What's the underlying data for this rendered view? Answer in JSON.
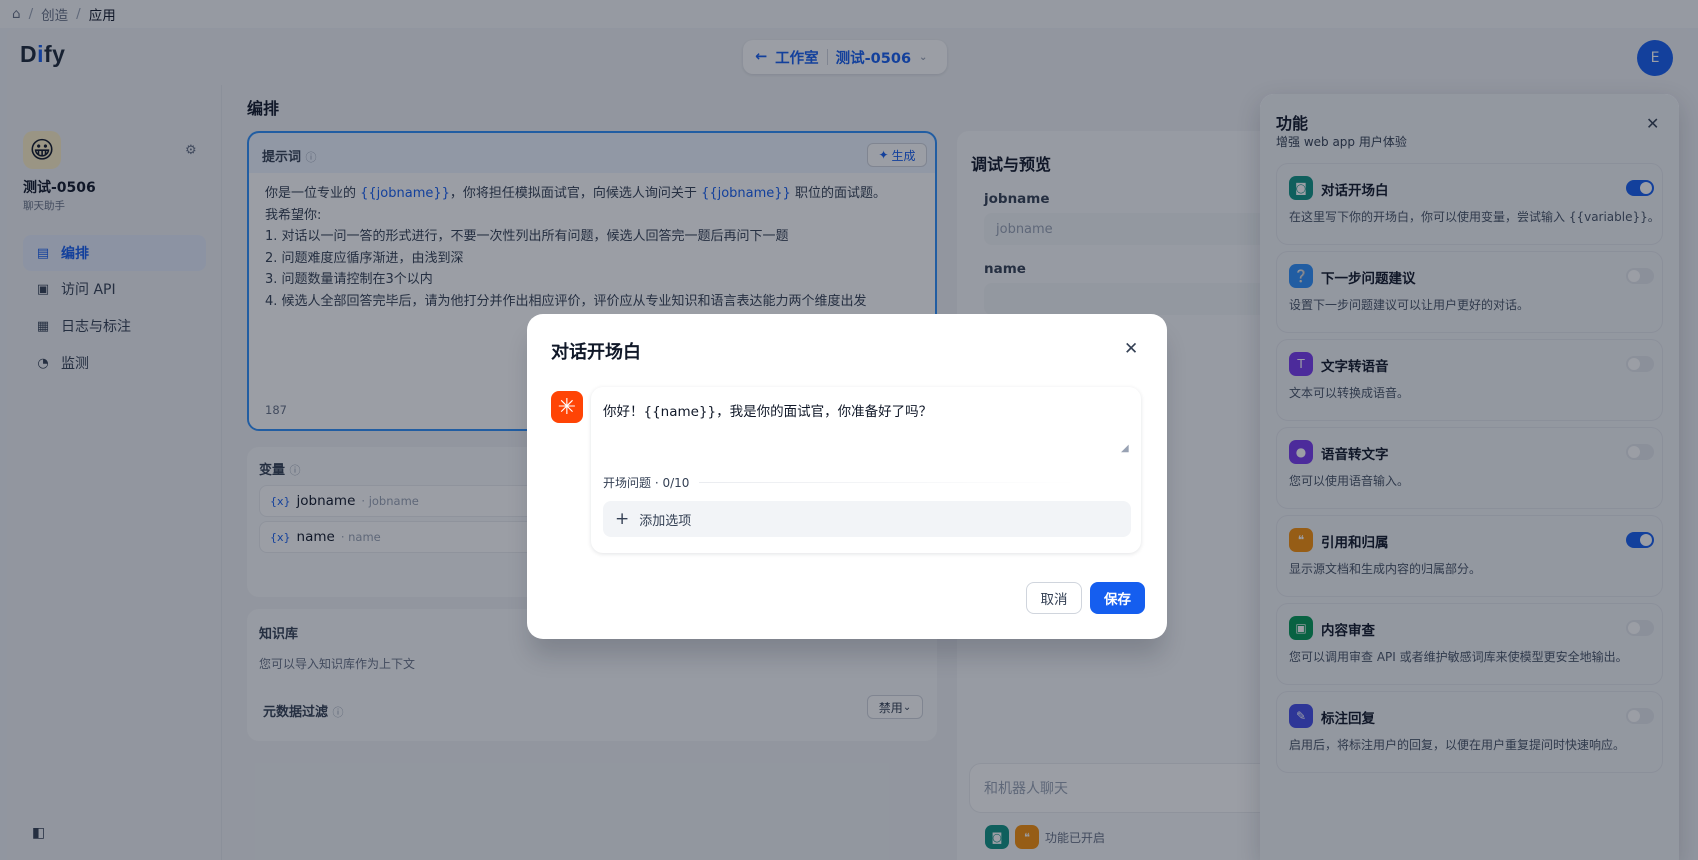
{
  "breadcrumb": {
    "items": [
      "创造",
      "应用"
    ]
  },
  "header": {
    "logo": "Dify",
    "back_label": "工作室",
    "app_switch": "测试-0506",
    "user_initial": "E"
  },
  "sidebar": {
    "app_name": "测试-0506",
    "app_type": "聊天助手",
    "items": [
      {
        "label": "编排",
        "icon": "layout-icon"
      },
      {
        "label": "访问 API",
        "icon": "terminal-icon"
      },
      {
        "label": "日志与标注",
        "icon": "file-list-icon"
      },
      {
        "label": "监测",
        "icon": "gauge-icon"
      }
    ]
  },
  "orchestrate": {
    "title": "编排",
    "prompt": {
      "label": "提示词",
      "generate": "生成",
      "line1_a": "你是一位专业的 ",
      "line1_var1": "{{jobname}}",
      "line1_b": "，你将担任模拟面试官，向候选人询问关于 ",
      "line1_var2": "{{jobname}}",
      "line1_c": " 职位的面试题。",
      "lines": [
        "我希望你:",
        "1. 对话以一问一答的形式进行，不要一次性列出所有问题，候选人回答完一题后再问下一题",
        "2. 问题难度应循序渐进，由浅到深",
        "3. 问题数量请控制在3个以内",
        "4. 候选人全部回答完毕后，请为他打分并作出相应评价，评价应从专业知识和语言表达能力两个维度出发"
      ],
      "char_count": "187"
    },
    "variables": {
      "title": "变量",
      "items": [
        {
          "name": "jobname",
          "key": "· jobname"
        },
        {
          "name": "name",
          "key": "· name"
        }
      ]
    },
    "knowledge": {
      "title": "知识库",
      "desc": "您可以导入知识库作为上下文",
      "meta_filter": "元数据过滤",
      "meta_value": "禁用"
    }
  },
  "debug": {
    "title": "调试与预览",
    "fields": [
      {
        "label": "jobname",
        "placeholder": "jobname"
      },
      {
        "label": "name",
        "placeholder": ""
      }
    ],
    "chat_placeholder": "和机器人聊天",
    "features_on": "功能已开启"
  },
  "features": {
    "title": "功能",
    "subtitle": "增强 web app 用户体验",
    "items": [
      {
        "title": "对话开场白",
        "desc": "在这里写下你的开场白，你可以使用变量，尝试输入 {{variable}}。",
        "enabled": true,
        "color": "#0e9384",
        "icon": "chat-bubble-icon"
      },
      {
        "title": "下一步问题建议",
        "desc": "设置下一步问题建议可以让用户更好的对话。",
        "enabled": false,
        "color": "#2e90fa",
        "icon": "message-question-icon"
      },
      {
        "title": "文字转语音",
        "desc": "文本可以转换成语音。",
        "enabled": false,
        "color": "#7839ee",
        "icon": "text-to-speech-icon"
      },
      {
        "title": "语音转文字",
        "desc": "您可以使用语音输入。",
        "enabled": false,
        "color": "#7839ee",
        "icon": "microphone-icon"
      },
      {
        "title": "引用和归属",
        "desc": "显示源文档和生成内容的归属部分。",
        "enabled": true,
        "color": "#f79009",
        "icon": "quote-icon"
      },
      {
        "title": "内容审查",
        "desc": "您可以调用审查 API 或者维护敏感词库来使模型更安全地输出。",
        "enabled": false,
        "color": "#039855",
        "icon": "shield-check-icon"
      },
      {
        "title": "标注回复",
        "desc": "启用后，将标注用户的回复，以便在用户重复提问时快速响应。",
        "enabled": false,
        "color": "#444ce7",
        "icon": "annotation-icon"
      }
    ]
  },
  "modal": {
    "title": "对话开场白",
    "opening_text": "你好！{{name}}，我是你的面试官，你准备好了吗？",
    "questions_label": "开场问题 · 0/10",
    "add_option": "添加选项",
    "cancel": "取消",
    "save": "保存"
  }
}
